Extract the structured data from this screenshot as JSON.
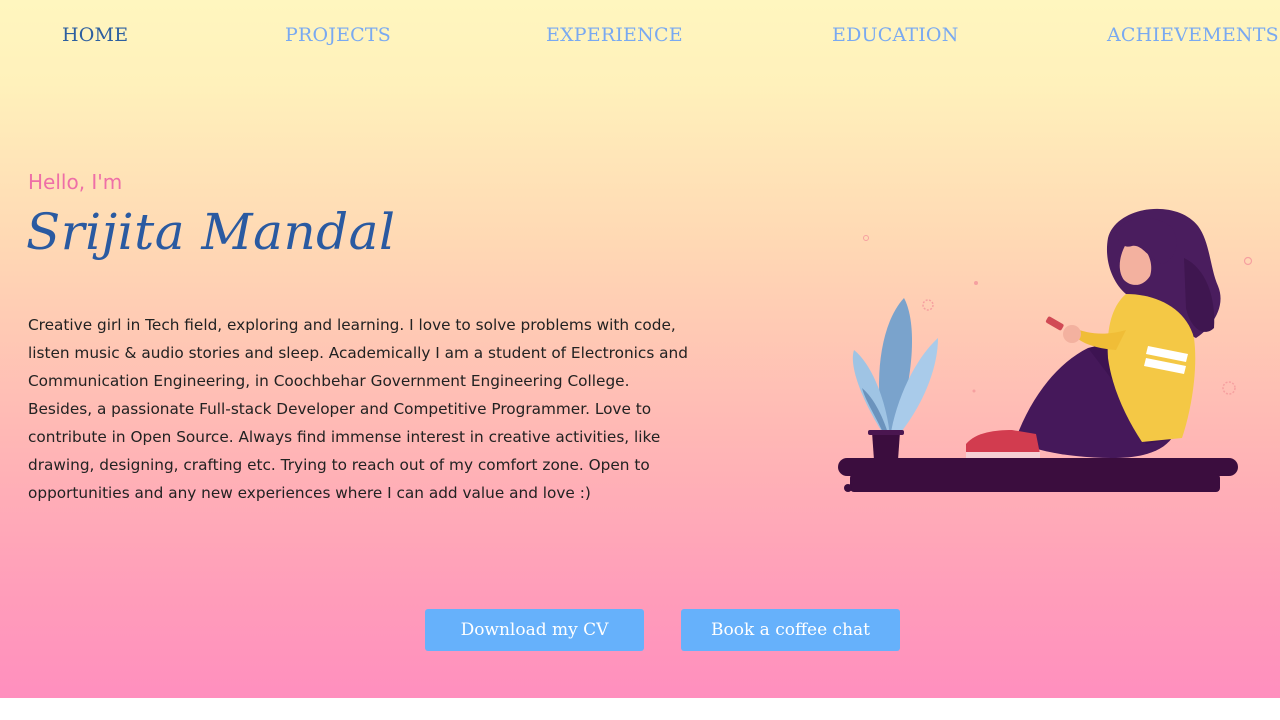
{
  "nav": {
    "items": [
      {
        "label": "HOME",
        "active": true
      },
      {
        "label": "PROJECTS"
      },
      {
        "label": "EXPERIENCE"
      },
      {
        "label": "EDUCATION"
      },
      {
        "label": "ACHIEVEMENTS"
      }
    ]
  },
  "hero": {
    "greeting": "Hello, I'm",
    "name": "Srijita Mandal",
    "bio": "Creative girl in Tech field, exploring and learning. I love to solve problems with code, listen music & audio stories and sleep. Academically I am a student of Electronics and Communication Engineering, in Coochbehar Government Engineering College. Besides, a passionate Full-stack Developer and Competitive Programmer. Love to contribute in Open Source. Always find immense interest in creative activities, like drawing, designing, crafting etc. Trying to reach out of my comfort zone. Open to opportunities and any new experiences where I can add value and love :)"
  },
  "buttons": {
    "cv": "Download my CV",
    "chat": "Book a coffee chat"
  },
  "colors": {
    "accent_blue": "#66b1fb",
    "nav_active": "#2d5fa0",
    "nav_link": "#79a9f1",
    "greeting_pink": "#ee6fa7",
    "name_blue": "#2a5aa1"
  },
  "illustration": {
    "icon": "girl-with-phone-illustration"
  }
}
